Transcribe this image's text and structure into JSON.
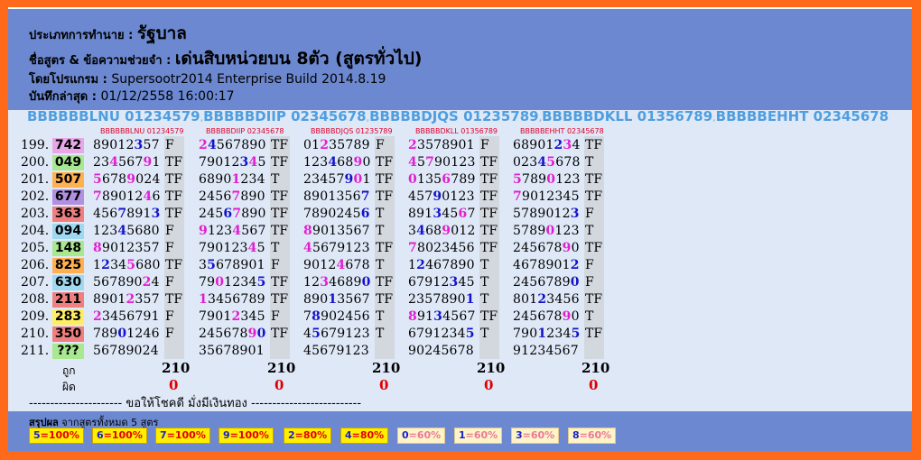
{
  "header": {
    "type_key": "ประเภทการทำนาย : ",
    "type_val": "รัฐบาล",
    "formula_key": "ชื่อสูตร & ข้อความช่วยจำ : ",
    "formula_val": "เด่นสิบหน่วยบน 8ตัว (สูตรทั่วไป)",
    "program_key": "โดยโปรแกรม : ",
    "program_val": "Supersootr2014 Enterprise Build 2014.8.19",
    "saved_key": "บันทึกล่าสุด : ",
    "saved_val": "01/12/2558 16:00:17"
  },
  "formulas": [
    "BBBBBBLNU 01234579",
    "BBBBBDIIP 02345678",
    "BBBBBDJQS 01235789",
    "BBBBBDKLL 01356789",
    "BBBBBEHHT 02345678"
  ],
  "col_headers": [
    "BBBBBBLNU 01234579",
    "BBBBBDIIP 02345678",
    "BBBBBDJQS 01235789",
    "BBBBBDKLL 01356789",
    "BBBBBEHHT 02345678"
  ],
  "rows": [
    {
      "label": "199.",
      "num": "742",
      "color": "#e8a8e8",
      "cells": [
        [
          "89012357",
          "F",
          [
            5
          ]
        ],
        [
          "24567890",
          "TF",
          [
            0,
            1
          ]
        ],
        [
          "01235789",
          "F",
          [
            2
          ]
        ],
        [
          "23578901",
          "F",
          [
            0
          ]
        ],
        [
          "68901234",
          "TF",
          [
            5,
            6
          ]
        ]
      ]
    },
    {
      "label": "200.",
      "num": "049",
      "color": "#a8e890",
      "cells": [
        [
          "23456791",
          "TF",
          [
            2,
            6
          ]
        ],
        [
          "79012345",
          "TF",
          [
            5,
            6
          ]
        ],
        [
          "12346890",
          "TF",
          [
            3,
            6
          ]
        ],
        [
          "45790123",
          "TF",
          [
            0,
            2
          ]
        ],
        [
          "02345678",
          "T",
          [
            3,
            4
          ]
        ]
      ]
    },
    {
      "label": "201.",
      "num": "507",
      "color": "#ffb050",
      "cells": [
        [
          "56789024",
          "TF",
          [
            0,
            4
          ]
        ],
        [
          "68901234",
          "T",
          [
            4
          ]
        ],
        [
          "23457901",
          "TF",
          [
            5,
            6
          ]
        ],
        [
          "01356789",
          "TF",
          [
            0,
            4
          ]
        ],
        [
          "57890123",
          "TF",
          [
            0,
            4
          ]
        ]
      ]
    },
    {
      "label": "202.",
      "num": "677",
      "color": "#b090e0",
      "cells": [
        [
          "78901246",
          "TF",
          [
            0,
            6
          ]
        ],
        [
          "24567890",
          "TF",
          [
            4
          ]
        ],
        [
          "89013567",
          "TF",
          [
            7
          ]
        ],
        [
          "45790123",
          "TF",
          [
            3
          ]
        ],
        [
          "79012345",
          "TF",
          [
            0
          ]
        ]
      ]
    },
    {
      "label": "203.",
      "num": "363",
      "color": "#f08080",
      "cells": [
        [
          "45678913",
          "TF",
          [
            3,
            7
          ]
        ],
        [
          "24567890",
          "TF",
          [
            3,
            4
          ]
        ],
        [
          "78902456",
          "T",
          [
            7
          ]
        ],
        [
          "89134567",
          "TF",
          [
            3,
            6
          ]
        ],
        [
          "57890123",
          "F",
          [
            7
          ]
        ]
      ]
    },
    {
      "label": "204.",
      "num": "094",
      "color": "#a0d8f0",
      "cells": [
        [
          "12345680",
          "F",
          [
            3
          ]
        ],
        [
          "91234567",
          "TF",
          [
            0,
            4
          ]
        ],
        [
          "89013567",
          "T",
          [
            0
          ]
        ],
        [
          "34689012",
          "TF",
          [
            1,
            4
          ]
        ],
        [
          "57890123",
          "T",
          [
            4
          ]
        ]
      ]
    },
    {
      "label": "205.",
      "num": "148",
      "color": "#a8e890",
      "cells": [
        [
          "89012357",
          "F",
          [
            0
          ]
        ],
        [
          "79012345",
          "T",
          [
            6
          ]
        ],
        [
          "45679123",
          "TF",
          [
            0
          ]
        ],
        [
          "78023456",
          "TF",
          [
            0
          ]
        ],
        [
          "24567890",
          "TF",
          [
            6
          ]
        ]
      ]
    },
    {
      "label": "206.",
      "num": "825",
      "color": "#ffb050",
      "cells": [
        [
          "12345680",
          "TF",
          [
            1,
            4
          ]
        ],
        [
          "35678901",
          "F",
          [
            1
          ]
        ],
        [
          "90124678",
          "T",
          [
            4
          ]
        ],
        [
          "12467890",
          "T",
          [
            1
          ]
        ],
        [
          "46789012",
          "F",
          [
            7
          ]
        ]
      ]
    },
    {
      "label": "207.",
      "num": "630",
      "color": "#a0d8f0",
      "cells": [
        [
          "56789024",
          "F",
          [
            6
          ]
        ],
        [
          "79012345",
          "TF",
          [
            2,
            7
          ]
        ],
        [
          "12346890",
          "TF",
          [
            2,
            7
          ]
        ],
        [
          "67912345",
          "T",
          [
            5
          ]
        ],
        [
          "24567890",
          "F",
          [
            7
          ]
        ]
      ]
    },
    {
      "label": "208.",
      "num": "211",
      "color": "#f08080",
      "cells": [
        [
          "89012357",
          "TF",
          [
            4
          ]
        ],
        [
          "13456789",
          "TF",
          [
            0
          ]
        ],
        [
          "89013567",
          "TF",
          [
            3
          ]
        ],
        [
          "23578901",
          "T",
          [
            7
          ]
        ],
        [
          "80123456",
          "TF",
          [
            3
          ]
        ]
      ]
    },
    {
      "label": "209.",
      "num": "283",
      "color": "#ffee60",
      "cells": [
        [
          "23456791",
          "F",
          [
            0
          ]
        ],
        [
          "79012345",
          "F",
          [
            4
          ]
        ],
        [
          "78902456",
          "T",
          [
            1
          ]
        ],
        [
          "89134567",
          "TF",
          [
            0,
            3
          ]
        ],
        [
          "24567890",
          "T",
          [
            6
          ]
        ]
      ]
    },
    {
      "label": "210.",
      "num": "350",
      "color": "#f08080",
      "cells": [
        [
          "78901246",
          "F",
          [
            3
          ]
        ],
        [
          "24567890",
          "TF",
          [
            6,
            7
          ]
        ],
        [
          "45679123",
          "T",
          [
            1
          ]
        ],
        [
          "67912345",
          "T",
          [
            7
          ]
        ],
        [
          "79012345",
          "TF",
          [
            3,
            7
          ]
        ]
      ]
    },
    {
      "label": "211.",
      "num": "???",
      "color": "#a8e890",
      "cells": [
        [
          "56789024",
          "",
          []
        ],
        [
          "35678901",
          "",
          []
        ],
        [
          "45679123",
          "",
          []
        ],
        [
          "90245678",
          "",
          []
        ],
        [
          "91234567",
          "",
          []
        ]
      ]
    }
  ],
  "results": {
    "right_label": "ถูก",
    "wrong_label": "ผิด",
    "totals": [
      "210",
      "210",
      "210",
      "210",
      "210"
    ],
    "zeros": [
      "0",
      "0",
      "0",
      "0",
      "0"
    ]
  },
  "luck_text": "---------------------- ขอให้โชคดี มั่งมีเงินทอง --------------------------",
  "summary": {
    "title_bold": "สรุปผล",
    "title_rest": " จากสูตรทั้งหมด 5 สูตร",
    "badges": [
      {
        "n": "5",
        "p": "=100%",
        "hi": true
      },
      {
        "n": "6",
        "p": "=100%",
        "hi": true
      },
      {
        "n": "7",
        "p": "=100%",
        "hi": true
      },
      {
        "n": "9",
        "p": "=100%",
        "hi": true
      },
      {
        "n": "2",
        "p": "=80%",
        "hi": true
      },
      {
        "n": "4",
        "p": "=80%",
        "hi": true
      },
      {
        "n": "0",
        "p": "=60%",
        "hi": false
      },
      {
        "n": "1",
        "p": "=60%",
        "hi": false
      },
      {
        "n": "3",
        "p": "=60%",
        "hi": false
      },
      {
        "n": "8",
        "p": "=60%",
        "hi": false
      }
    ]
  }
}
